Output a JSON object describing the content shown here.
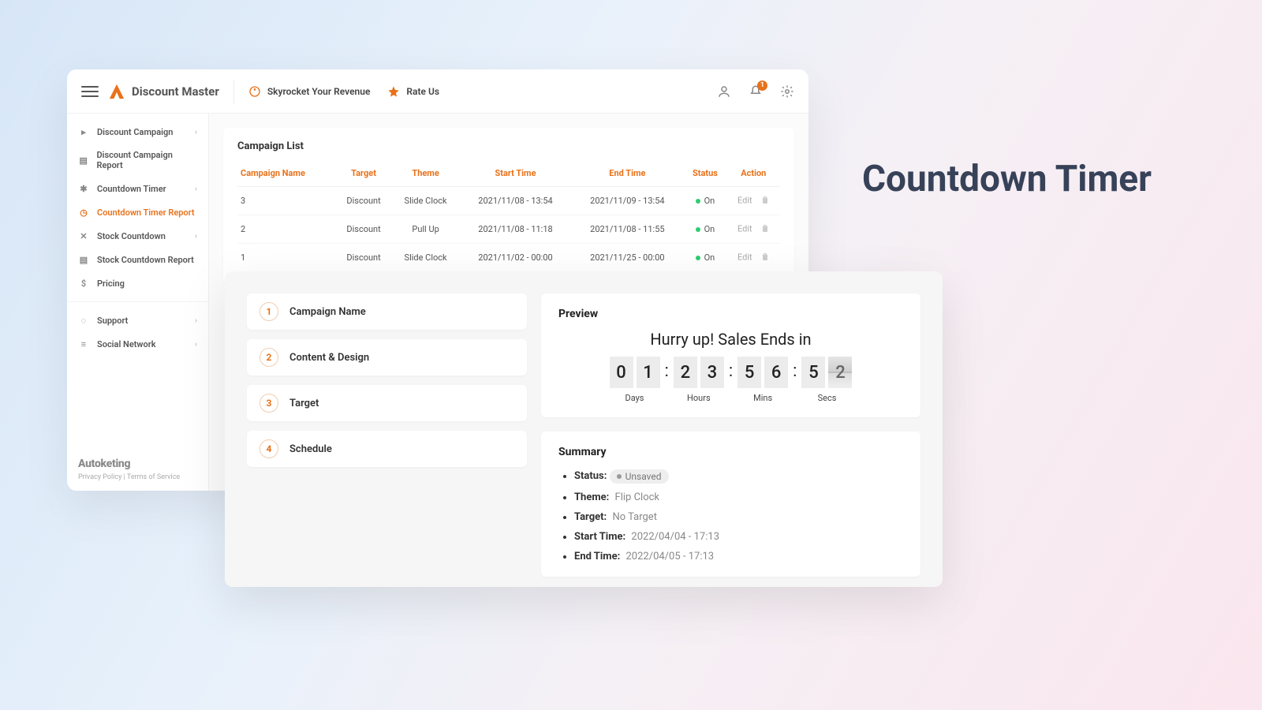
{
  "hero": {
    "title": "Countdown Timer"
  },
  "topbar": {
    "app_name": "Discount Master",
    "revenue_label": "Skyrocket Your Revenue",
    "rate_label": "Rate Us",
    "notif_count": "1"
  },
  "sidebar": {
    "items": [
      {
        "label": "Discount Campaign",
        "chev": true
      },
      {
        "label": "Discount Campaign Report",
        "chev": false
      },
      {
        "label": "Countdown Timer",
        "chev": true
      },
      {
        "label": "Countdown Timer Report",
        "chev": false,
        "active": true
      },
      {
        "label": "Stock Countdown",
        "chev": true
      },
      {
        "label": "Stock Countdown Report",
        "chev": false
      },
      {
        "label": "Pricing",
        "chev": false
      }
    ],
    "secondary": [
      {
        "label": "Support",
        "chev": true
      },
      {
        "label": "Social Network",
        "chev": true
      }
    ],
    "footer_brand": "Autoketing",
    "footer_legal": "Privacy Policy | Terms of Service"
  },
  "campaign_list": {
    "title": "Campaign List",
    "headers": [
      "Campaign Name",
      "Target",
      "Theme",
      "Start Time",
      "End Time",
      "Status",
      "Action"
    ],
    "rows": [
      {
        "name": "3",
        "target": "Discount",
        "theme": "Slide Clock",
        "start": "2021/11/08 - 13:54",
        "end": "2021/11/09 - 13:54",
        "status": "On",
        "action": "Edit"
      },
      {
        "name": "2",
        "target": "Discount",
        "theme": "Pull Up",
        "start": "2021/11/08 - 11:18",
        "end": "2021/11/08 - 11:55",
        "status": "On",
        "action": "Edit"
      },
      {
        "name": "1",
        "target": "Discount",
        "theme": "Slide Clock",
        "start": "2021/11/02 - 00:00",
        "end": "2021/11/25 - 00:00",
        "status": "On",
        "action": "Edit"
      }
    ]
  },
  "editor": {
    "steps": [
      {
        "num": "1",
        "label": "Campaign Name"
      },
      {
        "num": "2",
        "label": "Content & Design"
      },
      {
        "num": "3",
        "label": "Target"
      },
      {
        "num": "4",
        "label": "Schedule"
      }
    ],
    "preview": {
      "title": "Preview",
      "headline": "Hurry up! Sales Ends in",
      "days": {
        "d1": "0",
        "d2": "1",
        "label": "Days"
      },
      "hours": {
        "d1": "2",
        "d2": "3",
        "label": "Hours"
      },
      "mins": {
        "d1": "5",
        "d2": "6",
        "label": "Mins"
      },
      "secs": {
        "d1": "5",
        "d2": "2",
        "label": "Secs"
      },
      "colon": ":"
    },
    "summary": {
      "title": "Summary",
      "status_label": "Status:",
      "status_value": "Unsaved",
      "theme_label": "Theme:",
      "theme_value": "Flip Clock",
      "target_label": "Target:",
      "target_value": "No Target",
      "start_label": "Start Time:",
      "start_value": "2022/04/04 - 17:13",
      "end_label": "End Time:",
      "end_value": "2022/04/05 - 17:13"
    }
  }
}
